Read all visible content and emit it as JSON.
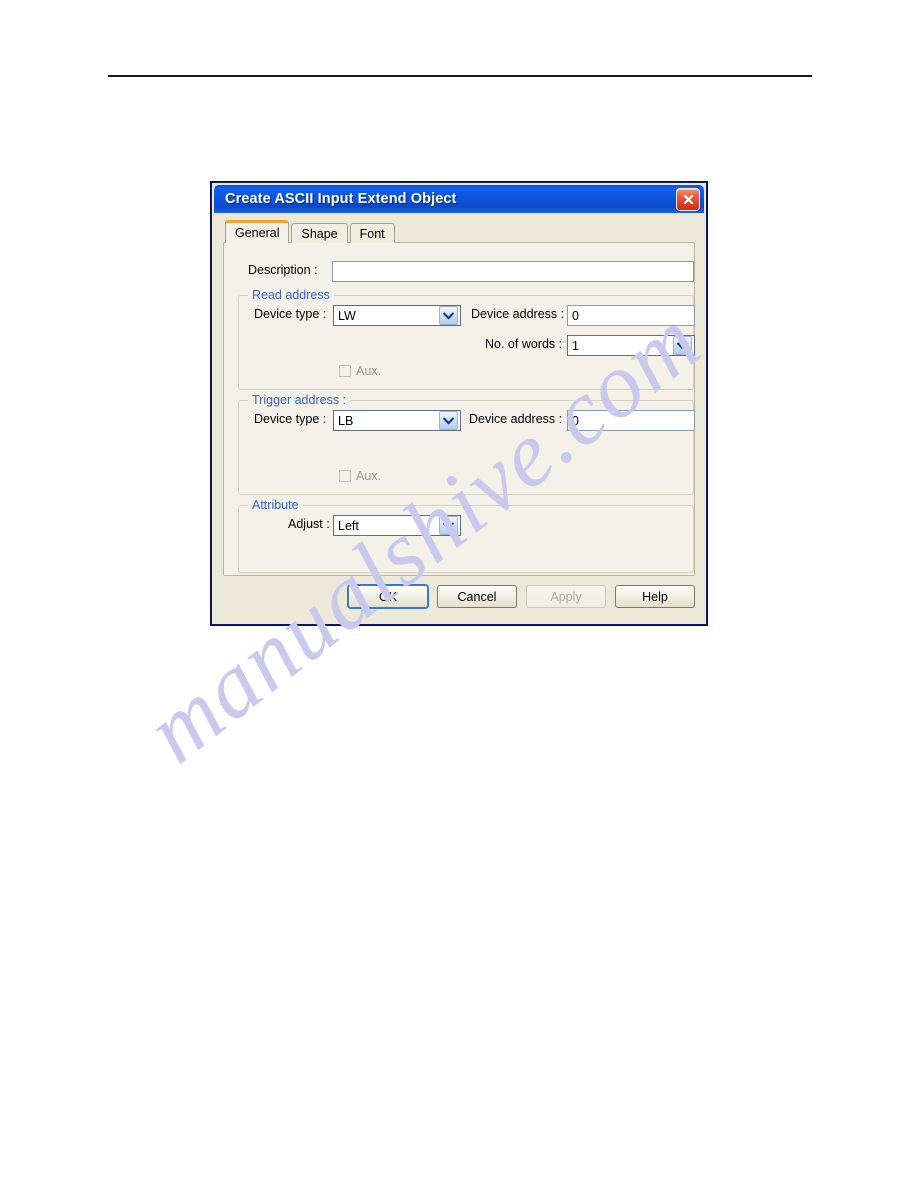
{
  "page": {
    "background": "#ffffff",
    "rule": "horizontal-rule"
  },
  "watermark": {
    "text": "manualshive.com",
    "color": "#c9c9ee"
  },
  "dialog": {
    "title": "Create ASCII Input Extend Object",
    "title_bar_color": "#0d55e0",
    "close_label": "Close",
    "tabs": [
      {
        "label": "General",
        "active": true
      },
      {
        "label": "Shape",
        "active": false
      },
      {
        "label": "Font",
        "active": false
      }
    ],
    "description": {
      "label": "Description :",
      "value": "",
      "placeholder": ""
    },
    "read_address": {
      "title": "Read address",
      "device_type_label": "Device type :",
      "device_type_value": "LW",
      "device_address_label": "Device address :",
      "device_address_value": "0",
      "no_of_words_label": "No. of words :",
      "no_of_words_value": "1",
      "aux_label": "Aux.",
      "aux_checked": false,
      "aux_disabled": true
    },
    "trigger_address": {
      "title": "Trigger address :",
      "device_type_label": "Device type :",
      "device_type_value": "LB",
      "device_address_label": "Device  address :",
      "device_address_value": "0",
      "aux_label": "Aux.",
      "aux_checked": false,
      "aux_disabled": true
    },
    "attribute": {
      "title": "Attribute",
      "adjust_label": "Adjust :",
      "adjust_value": "Left"
    },
    "buttons": {
      "ok": "OK",
      "cancel": "Cancel",
      "apply": "Apply",
      "help": "Help",
      "apply_disabled": true
    },
    "group_title_color": "#3a5fcd"
  }
}
